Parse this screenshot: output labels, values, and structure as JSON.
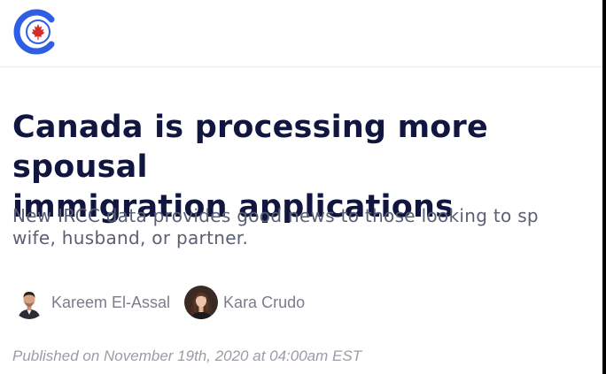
{
  "header": {
    "logo_icon": "canada-maple-leaf-logo-icon",
    "brand_color": "#2e5fe3",
    "leaf_color": "#d62a2a"
  },
  "article": {
    "title_line1": "Canada is processing more spousal",
    "title_line2": "immigration applications",
    "subtitle_line1": "New IRCC data provides good news to those looking to sp",
    "subtitle_line2": "wife, husband, or partner.",
    "authors": [
      {
        "name": "Kareem El-Assal",
        "avatar_icon": "man-avatar-icon"
      },
      {
        "name": "Kara Crudo",
        "avatar_icon": "woman-avatar-icon"
      }
    ],
    "published": "Published on November 19th, 2020 at 04:00am EST"
  },
  "colors": {
    "title": "#10163f",
    "subtitle": "#5b5f73",
    "author": "#7b7c8c",
    "published": "#9a9ca8"
  }
}
